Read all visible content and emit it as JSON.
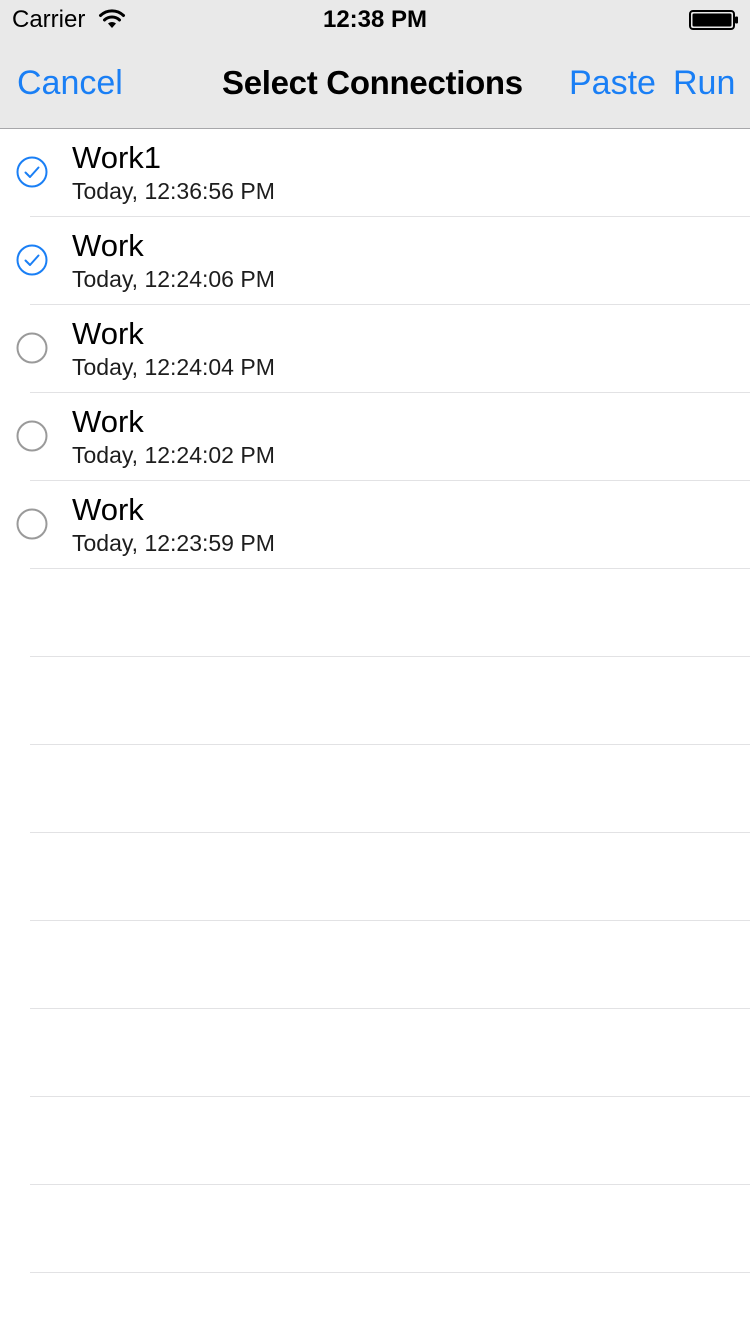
{
  "status_bar": {
    "carrier": "Carrier",
    "time": "12:38 PM",
    "wifi_icon": "wifi-icon",
    "battery_icon": "battery-full-icon"
  },
  "nav": {
    "cancel_label": "Cancel",
    "title": "Select Connections",
    "paste_label": "Paste",
    "run_label": "Run"
  },
  "colors": {
    "accent": "#1a7ff5",
    "nav_background": "#e9e9e9",
    "unchecked_circle": "#9a9a9a"
  },
  "connections": [
    {
      "title": "Work1",
      "subtitle": "Today, 12:36:56 PM",
      "selected": true
    },
    {
      "title": "Work",
      "subtitle": "Today, 12:24:06 PM",
      "selected": true
    },
    {
      "title": "Work",
      "subtitle": "Today, 12:24:04 PM",
      "selected": false
    },
    {
      "title": "Work",
      "subtitle": "Today, 12:24:02 PM",
      "selected": false
    },
    {
      "title": "Work",
      "subtitle": "Today, 12:23:59 PM",
      "selected": false
    }
  ]
}
